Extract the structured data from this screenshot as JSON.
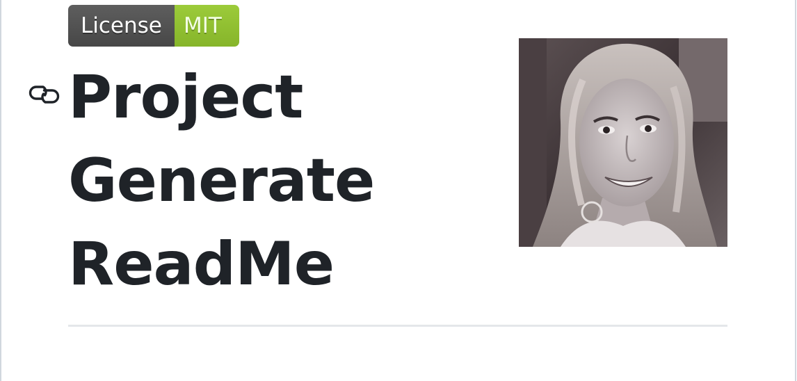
{
  "badge": {
    "label": "License",
    "value": "MIT",
    "label_color": "#555555",
    "value_color": "#97ca00"
  },
  "header": {
    "anchor_icon": "link-icon",
    "title_lines": [
      "Project",
      "Generate",
      "ReadMe"
    ]
  },
  "avatar": {
    "icon": "author-photo"
  },
  "colors": {
    "text": "#1f2328",
    "divider": "#e4e7ea",
    "frame": "#d0d7de"
  }
}
